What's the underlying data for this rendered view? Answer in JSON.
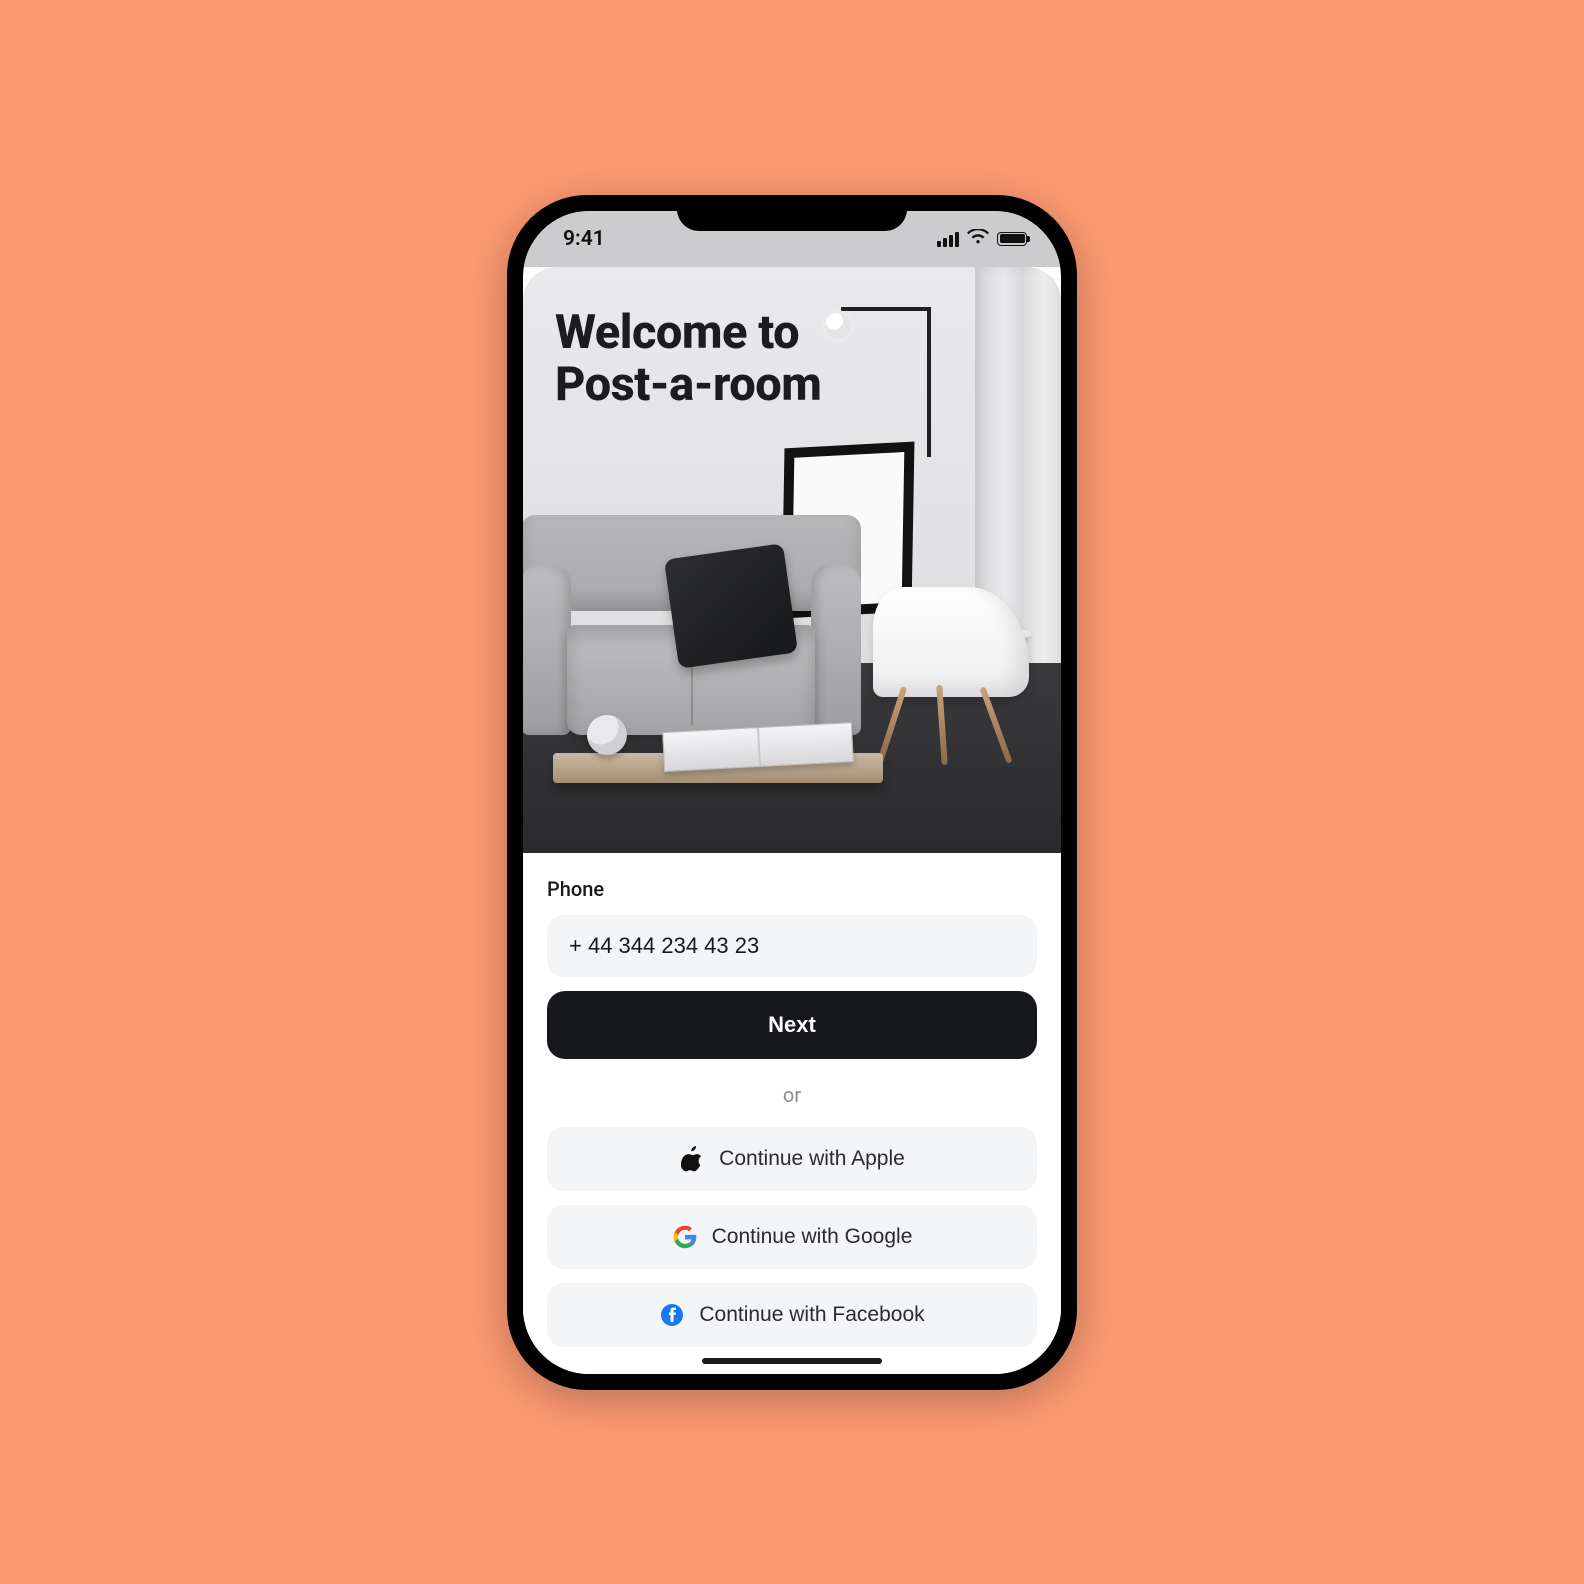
{
  "status": {
    "time": "9:41"
  },
  "hero": {
    "title": "Welcome to\nPost-a-room"
  },
  "form": {
    "phone_label": "Phone",
    "phone_value": "+ 44 344 234 43 23",
    "next_label": "Next",
    "or_label": "or"
  },
  "social": {
    "apple": "Continue with Apple",
    "google": "Continue with Google",
    "facebook": "Continue with Facebook"
  },
  "colors": {
    "page_bg": "#fb9971",
    "primary_btn": "#17181c",
    "secondary_btn": "#f4f5f7",
    "facebook": "#1877F2"
  }
}
